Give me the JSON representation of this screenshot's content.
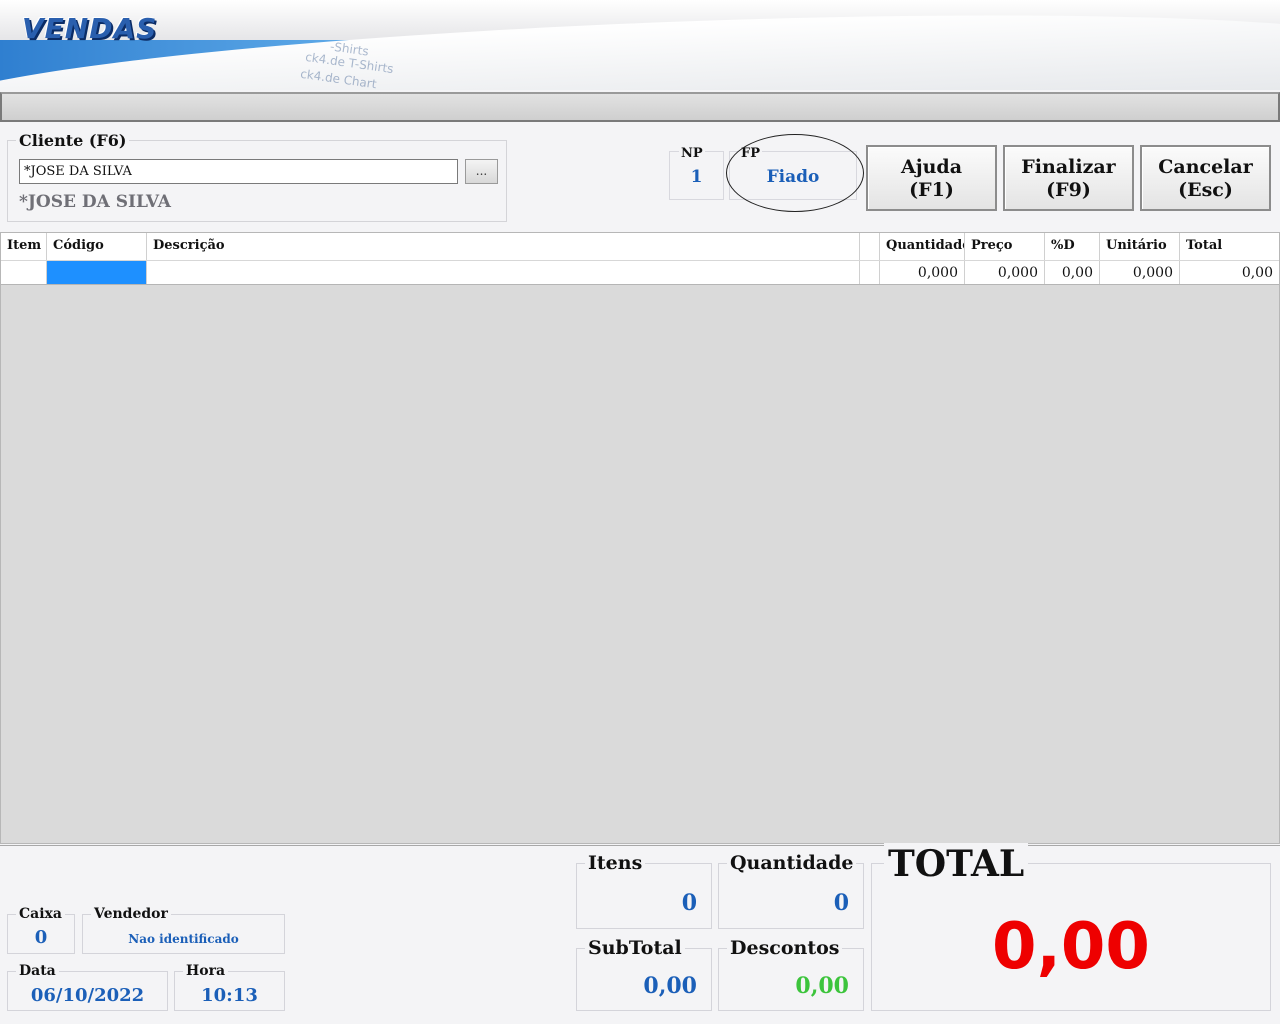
{
  "app": {
    "title": "VENDAS"
  },
  "banner": {
    "deco1": "-Shirts",
    "deco2": "ck4.de T-Shirts",
    "deco3": "ck4.de Chart"
  },
  "client": {
    "legend": "Cliente (F6)",
    "input_value": "*JOSE DA SILVA",
    "browse_label": "...",
    "display_name": "*JOSE DA SILVA"
  },
  "np": {
    "label": "NP",
    "value": "1"
  },
  "fp": {
    "label": "FP",
    "value": "Fiado"
  },
  "buttons": {
    "help": {
      "line1": "Ajuda",
      "line2": "(F1)"
    },
    "finish": {
      "line1": "Finalizar",
      "line2": "(F9)"
    },
    "cancel": {
      "line1": "Cancelar",
      "line2": "(Esc)"
    }
  },
  "grid": {
    "columns": [
      "Item",
      "Código",
      "Descrição",
      "",
      "Quantidade",
      "Preço",
      "%D",
      "Unitário",
      "Total"
    ],
    "row": [
      "",
      "",
      "",
      "",
      "0,000",
      "0,000",
      "0,00",
      "0,000",
      "0,00"
    ]
  },
  "bottom": {
    "caixa": {
      "label": "Caixa",
      "value": "0"
    },
    "vendedor": {
      "label": "Vendedor",
      "value": "Nao identificado"
    },
    "data": {
      "label": "Data",
      "value": "06/10/2022"
    },
    "hora": {
      "label": "Hora",
      "value": "10:13"
    },
    "itens": {
      "label": "Itens",
      "value": "0"
    },
    "quantidade": {
      "label": "Quantidade",
      "value": "0"
    },
    "subtotal": {
      "label": "SubTotal",
      "value": "0,00"
    },
    "descontos": {
      "label": "Descontos",
      "value": "0,00"
    },
    "total": {
      "label": "TOTAL",
      "value": "0,00"
    }
  },
  "colors": {
    "accent_blue": "#1b5fb8",
    "total_red": "#ee0000",
    "discount_green": "#3cc43c",
    "selected_cell": "#1e90ff"
  }
}
